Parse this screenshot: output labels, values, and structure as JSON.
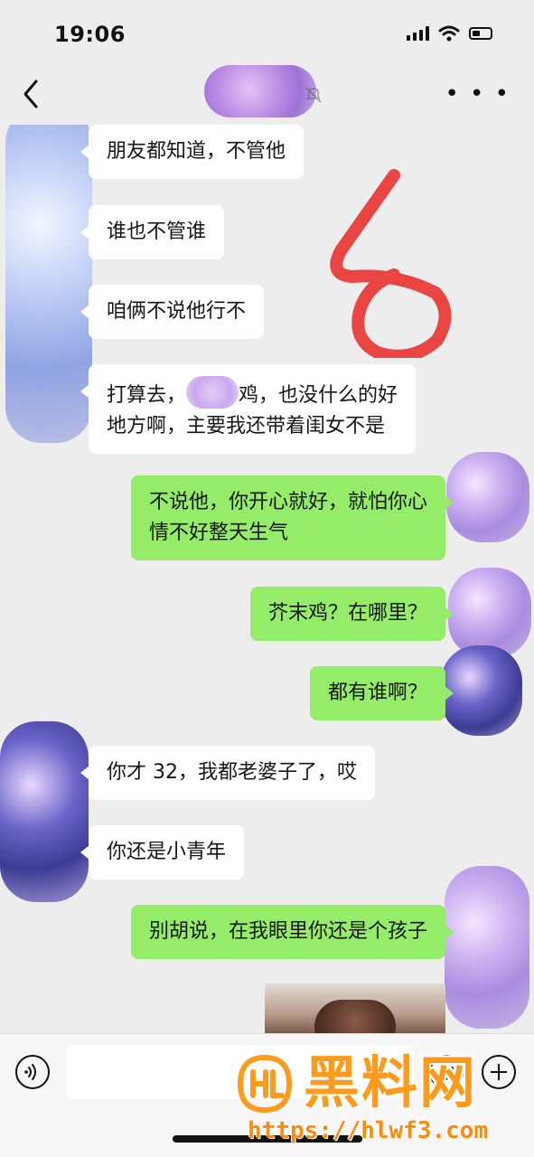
{
  "status_bar": {
    "time": "19:06"
  },
  "nav": {
    "back_icon": "chevron-left-icon",
    "more_icon": "more-dots-icon",
    "mute_icon": "bell-muted-icon"
  },
  "messages": [
    {
      "side": "left",
      "text": "朋友都知道，不管他"
    },
    {
      "side": "left",
      "text": "谁也不管谁"
    },
    {
      "side": "left",
      "text": "咱俩不说他行不"
    },
    {
      "side": "left",
      "text_line1_start": "打算去，",
      "text_line1_end": "鸡，也没什么的好",
      "text_line2": "地方啊，主要我还带着闺女不是"
    },
    {
      "side": "right",
      "text_line1": "不说他，你开心就好，就怕你心",
      "text_line2": "情不好整天生气"
    },
    {
      "side": "right",
      "text": "芥末鸡？在哪里？"
    },
    {
      "side": "right",
      "text": "都有谁啊？"
    },
    {
      "side": "left",
      "text": "你才 32，我都老婆子了，哎"
    },
    {
      "side": "left",
      "text": "你还是小青年"
    },
    {
      "side": "right",
      "text": "别胡说，在我眼里你还是个孩子"
    }
  ],
  "annotation": {
    "text": "6",
    "color": "#e8322f"
  },
  "input_bar": {
    "value": "",
    "voice_icon": "voice-icon",
    "emoji_icon": "emoji-icon",
    "plus_icon": "plus-icon"
  },
  "watermark": {
    "brand": "黑料网",
    "url": "https://hlwf3.com",
    "color": "#ff9a1c"
  },
  "colors": {
    "background": "#ededed",
    "bubble_left": "#ffffff",
    "bubble_right": "#95ec69"
  }
}
